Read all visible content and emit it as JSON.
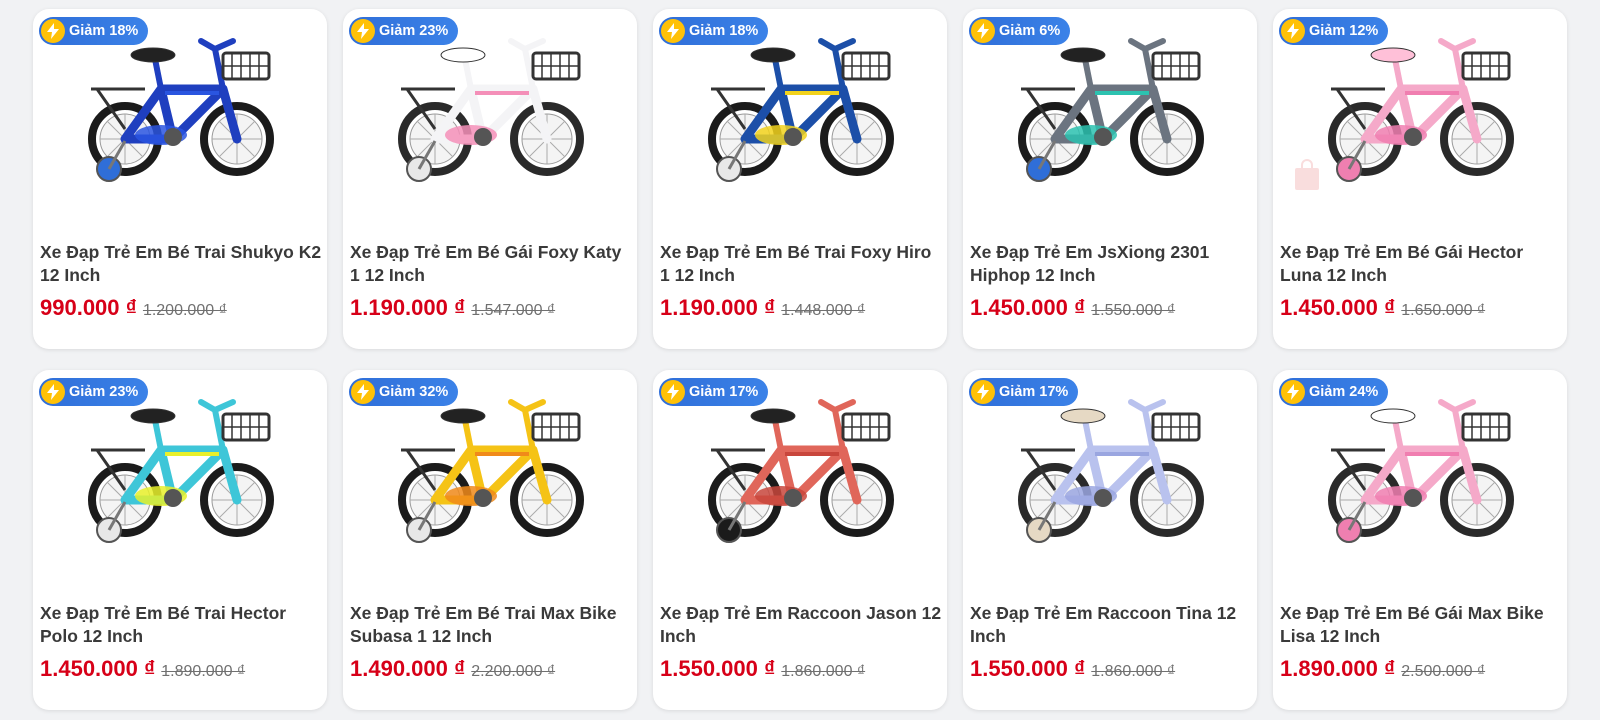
{
  "products": [
    {
      "badge": "Giảm 18%",
      "name": "Xe Đạp Trẻ Em Bé Trai Shukyo K2 12 Inch",
      "price": "990.000 ₫",
      "old_price": "1.200.000 ₫",
      "colors": {
        "frame": "#1f3fbf",
        "accent": "#2a55e0",
        "seat": "#222222",
        "wheel": "#1b1b1b",
        "training": "#2f6ed8"
      }
    },
    {
      "badge": "Giảm 23%",
      "name": "Xe Đạp Trẻ Em Bé Gái Foxy Katy 1 12 Inch",
      "price": "1.190.000 ₫",
      "old_price": "1.547.000 ₫",
      "colors": {
        "frame": "#f4f4f6",
        "accent": "#f48fb8",
        "seat": "#ffffff",
        "wheel": "#2a2a2a",
        "training": "#e8e8e8"
      }
    },
    {
      "badge": "Giảm 18%",
      "name": "Xe Đạp Trẻ Em Bé Trai Foxy Hiro 1 12 Inch",
      "price": "1.190.000 ₫",
      "old_price": "1.448.000 ₫",
      "colors": {
        "frame": "#1c4fa8",
        "accent": "#f2d21c",
        "seat": "#222222",
        "wheel": "#1b1b1b",
        "training": "#e8e8e8"
      }
    },
    {
      "badge": "Giảm 6%",
      "name": "Xe Đạp Trẻ Em JsXiong 2301 Hiphop 12 Inch",
      "price": "1.450.000 ₫",
      "old_price": "1.550.000 ₫",
      "colors": {
        "frame": "#6b7480",
        "accent": "#2cc2b0",
        "seat": "#222222",
        "wheel": "#1b1b1b",
        "training": "#2f6ed8"
      }
    },
    {
      "badge": "Giảm 12%",
      "name": "Xe Đạp Trẻ Em Bé Gái Hector Luna 12 Inch",
      "price": "1.450.000 ₫",
      "old_price": "1.650.000 ₫",
      "colors": {
        "frame": "#f5a9c9",
        "accent": "#f07eb0",
        "seat": "#ffc0d8",
        "wheel": "#2a2a2a",
        "training": "#ef7fb0"
      }
    },
    {
      "badge": "Giảm 23%",
      "name": "Xe Đạp Trẻ Em Bé Trai Hector Polo 12 Inch",
      "price": "1.450.000 ₫",
      "old_price": "1.890.000 ₫",
      "colors": {
        "frame": "#3ec6d8",
        "accent": "#e8f02a",
        "seat": "#222222",
        "wheel": "#1b1b1b",
        "training": "#e8e8e8"
      }
    },
    {
      "badge": "Giảm 32%",
      "name": "Xe Đạp Trẻ Em Bé Trai Max Bike Subasa 1 12 Inch",
      "price": "1.490.000 ₫",
      "old_price": "2.200.000 ₫",
      "colors": {
        "frame": "#f5c316",
        "accent": "#f08a1a",
        "seat": "#222222",
        "wheel": "#1b1b1b",
        "training": "#e8e8e8"
      }
    },
    {
      "badge": "Giảm 17%",
      "name": "Xe Đạp Trẻ Em Raccoon Jason 12 Inch",
      "price": "1.550.000 ₫",
      "old_price": "1.860.000 ₫",
      "colors": {
        "frame": "#e0665a",
        "accent": "#c8463c",
        "seat": "#222222",
        "wheel": "#1b1b1b",
        "training": "#1b1b1b"
      }
    },
    {
      "badge": "Giảm 17%",
      "name": "Xe Đạp Trẻ Em Raccoon Tina 12 Inch",
      "price": "1.550.000 ₫",
      "old_price": "1.860.000 ₫",
      "colors": {
        "frame": "#b9c2ee",
        "accent": "#9aa6e0",
        "seat": "#e6d9c4",
        "wheel": "#2a2a2a",
        "training": "#e6d9c4"
      }
    },
    {
      "badge": "Giảm 24%",
      "name": "Xe Đạp Trẻ Em Bé Gái Max Bike Lisa 12 Inch",
      "price": "1.890.000 ₫",
      "old_price": "2.500.000 ₫",
      "colors": {
        "frame": "#f5a9c9",
        "accent": "#f07eb0",
        "seat": "#ffffff",
        "wheel": "#2a2a2a",
        "training": "#ef7fb0"
      }
    }
  ],
  "icons": {
    "badge_icon": "lightning-bolt-icon",
    "image": "bicycle-image"
  },
  "theme": {
    "price_color": "#d70018",
    "badge_color": "#2f6ed8",
    "bolt_color": "#ffc107"
  }
}
